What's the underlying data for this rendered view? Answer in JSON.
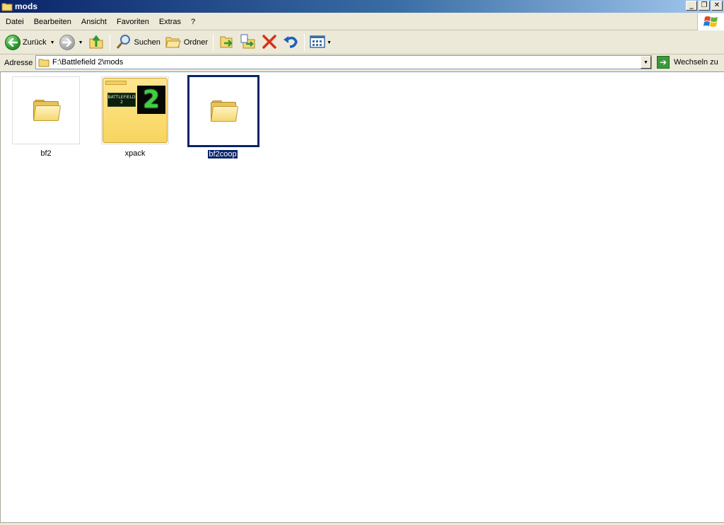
{
  "window": {
    "title": "mods",
    "controls": {
      "minimize": "_",
      "restore": "❐",
      "close": "✕"
    }
  },
  "menu": {
    "items": [
      "Datei",
      "Bearbeiten",
      "Ansicht",
      "Favoriten",
      "Extras",
      "?"
    ]
  },
  "toolbar": {
    "back_label": "Zurück",
    "search_label": "Suchen",
    "folders_label": "Ordner"
  },
  "address": {
    "label": "Adresse",
    "value": "F:\\Battlefield 2\\mods",
    "go_label": "Wechseln zu"
  },
  "items": [
    {
      "name": "bf2",
      "type": "folder",
      "selected": false
    },
    {
      "name": "xpack",
      "type": "folder-thumbnail",
      "selected": false
    },
    {
      "name": "bf2coop",
      "type": "folder",
      "selected": true
    }
  ],
  "xpack_thumbnail": {
    "logo_text": "BATTLEFIELD 2",
    "big_number": "2"
  },
  "colors": {
    "selection": "#0a246a",
    "folder": "#f5d874"
  },
  "icons": [
    "folder-icon",
    "back-arrow-icon",
    "forward-arrow-icon",
    "up-folder-icon",
    "search-icon",
    "folders-icon",
    "move-to-icon",
    "copy-to-icon",
    "delete-icon",
    "undo-icon",
    "views-icon",
    "go-arrow-icon",
    "windows-logo-icon"
  ]
}
